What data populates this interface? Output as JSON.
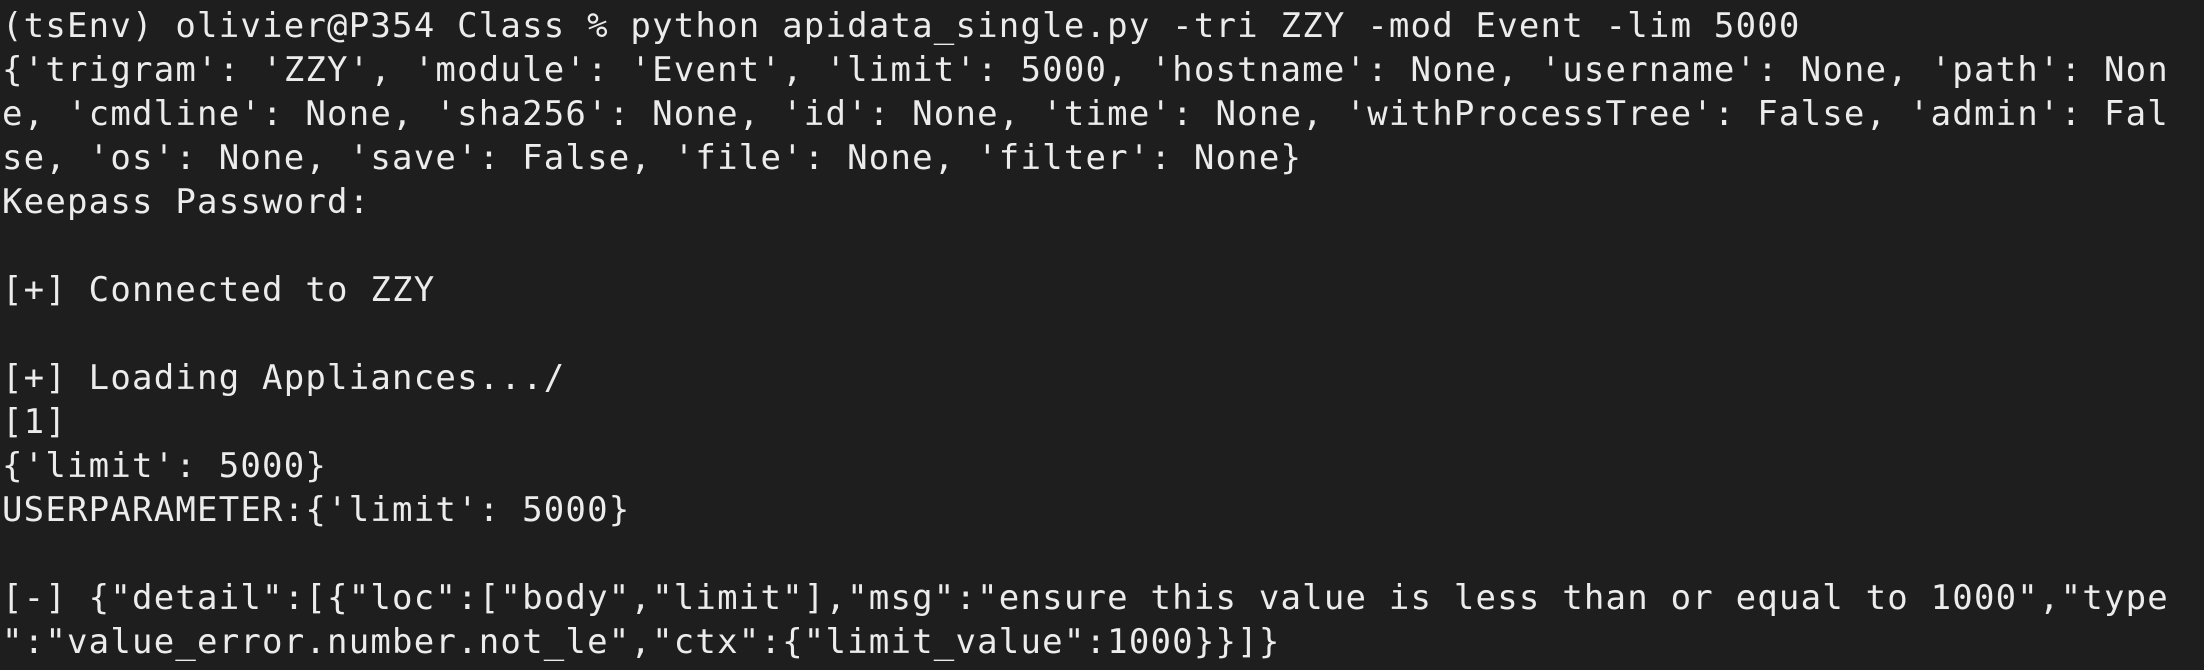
{
  "terminal": {
    "lines": [
      "(tsEnv) olivier@P354 Class % python apidata_single.py -tri ZZY -mod Event -lim 5000",
      "{'trigram': 'ZZY', 'module': 'Event', 'limit': 5000, 'hostname': None, 'username': None, 'path': Non",
      "e, 'cmdline': None, 'sha256': None, 'id': None, 'time': None, 'withProcessTree': False, 'admin': Fal",
      "se, 'os': None, 'save': False, 'file': None, 'filter': None}",
      "Keepass Password:",
      "",
      "[+] Connected to ZZY",
      "",
      "[+] Loading Appliances.../",
      "[1]",
      "{'limit': 5000}",
      "USERPARAMETER:{'limit': 5000}",
      "",
      "[-] {\"detail\":[{\"loc\":[\"body\",\"limit\"],\"msg\":\"ensure this value is less than or equal to 1000\",\"type",
      "\":\"value_error.number.not_le\",\"ctx\":{\"limit_value\":1000}}]}"
    ]
  }
}
